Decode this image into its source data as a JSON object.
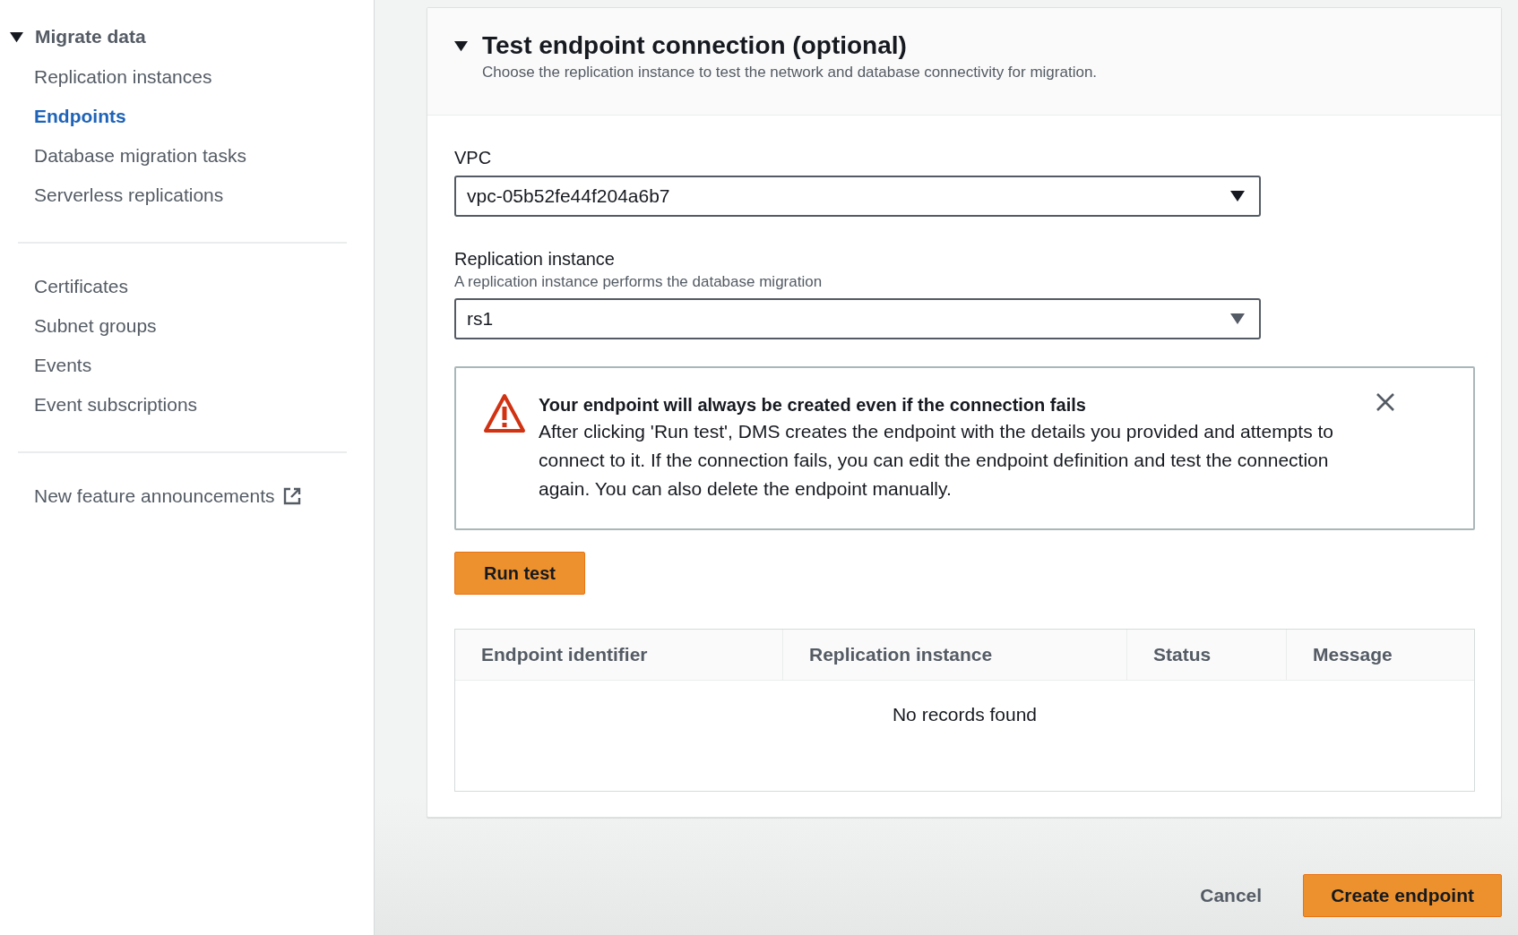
{
  "sidebar": {
    "section": {
      "label": "Migrate data",
      "expanded": true
    },
    "groups": [
      [
        {
          "label": "Replication instances",
          "selected": false,
          "kind": "link"
        },
        {
          "label": "Endpoints",
          "selected": true,
          "kind": "link"
        },
        {
          "label": "Database migration tasks",
          "selected": false,
          "kind": "link"
        },
        {
          "label": "Serverless replications",
          "selected": false,
          "kind": "link"
        }
      ],
      [
        {
          "label": "Certificates",
          "selected": false,
          "kind": "link"
        },
        {
          "label": "Subnet groups",
          "selected": false,
          "kind": "link"
        },
        {
          "label": "Events",
          "selected": false,
          "kind": "link"
        },
        {
          "label": "Event subscriptions",
          "selected": false,
          "kind": "link"
        }
      ],
      [
        {
          "label": "New feature announcements",
          "selected": false,
          "kind": "external"
        }
      ]
    ]
  },
  "panel": {
    "title": "Test endpoint connection (optional)",
    "expanded": true,
    "description": "Choose the replication instance to test the network and database connectivity for migration.",
    "fields": [
      {
        "label": "VPC",
        "value": "vpc-05b52fe44f204a6b7"
      },
      {
        "label": "Replication instance",
        "hint": "A replication instance performs the database migration",
        "value": "rs1"
      }
    ],
    "alert": {
      "title": "Your endpoint will always be created even if the connection fails",
      "body": "After clicking 'Run test', DMS creates the endpoint with the details you provided and attempts to connect to it. If the connection fails, you can edit the endpoint definition and test the connection again. You can also delete the endpoint manually."
    },
    "run_button": "Run test",
    "table": {
      "columns": [
        "Endpoint identifier",
        "Replication instance",
        "Status",
        "Message"
      ],
      "empty_message": "No records found"
    }
  },
  "footer": {
    "buttons": [
      {
        "label": "Cancel",
        "kind": "link"
      },
      {
        "label": "Create endpoint",
        "kind": "primary"
      }
    ]
  }
}
